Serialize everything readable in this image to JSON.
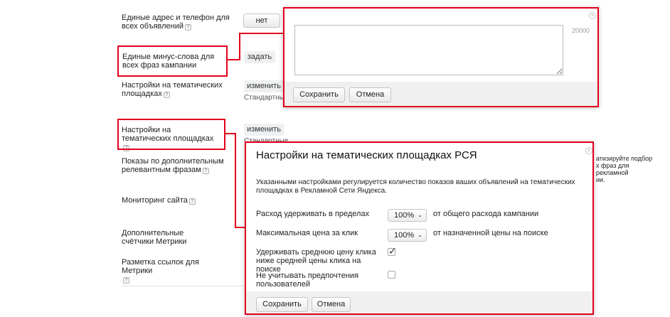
{
  "settings": {
    "unified_contacts": {
      "label": "Единые адрес и телефон для всех объявлений",
      "value": "нет"
    },
    "minus_words": {
      "label": "Единые минус-слова для всех фраз кампании",
      "action": "задать"
    },
    "platforms_1": {
      "label": "Настройки на тематических площадках",
      "action": "изменить",
      "status": "Стандартные"
    },
    "platforms_2": {
      "label": "Настройки на тематических площадках",
      "action": "изменить",
      "status": "Стандартные"
    },
    "extra_phrases": {
      "label": "Показы по дополнительным релевантным фразам",
      "side_text_1": "атизируйте подбор",
      "side_text_2": "х фраз для",
      "side_text_3": "рекламной",
      "side_text_4": "ии."
    },
    "site_monitoring": {
      "label": "Мониторинг сайта"
    },
    "metrika_counters": {
      "label": "Дополнительные счётчики Метрики"
    },
    "metrika_links": {
      "label": "Разметка ссылок для Метрики"
    },
    "help_glyph": "?"
  },
  "minus_popup": {
    "textarea_value": "",
    "char_limit": "20000",
    "save_label": "Сохранить",
    "cancel_label": "Отмена",
    "close_glyph": "×"
  },
  "rsya_popup": {
    "title": "Настройки на тематических площадках РСЯ",
    "description": "Указанными настройками регулируется количество показов ваших объявлений на тематических площадках в Рекламной Сети Яндекса.",
    "spend": {
      "label": "Расход удерживать в пределах",
      "value": "100%",
      "suffix": "от общего расхода кампании"
    },
    "max_price": {
      "label": "Максимальная цена за клик",
      "value": "100%",
      "suffix": "от назначенной цены на поиске"
    },
    "keep_avg": {
      "label": "Удерживать среднюю цену клика ниже средней цены клика на поиске",
      "checked": true
    },
    "ignore_prefs": {
      "label": "Не учитывать предпочтения пользователей",
      "checked": false
    },
    "save_label": "Сохранить",
    "cancel_label": "Отмена",
    "close_glyph": "×"
  },
  "colors": {
    "highlight": "#e3001b",
    "footer": "#f0f0f0"
  }
}
